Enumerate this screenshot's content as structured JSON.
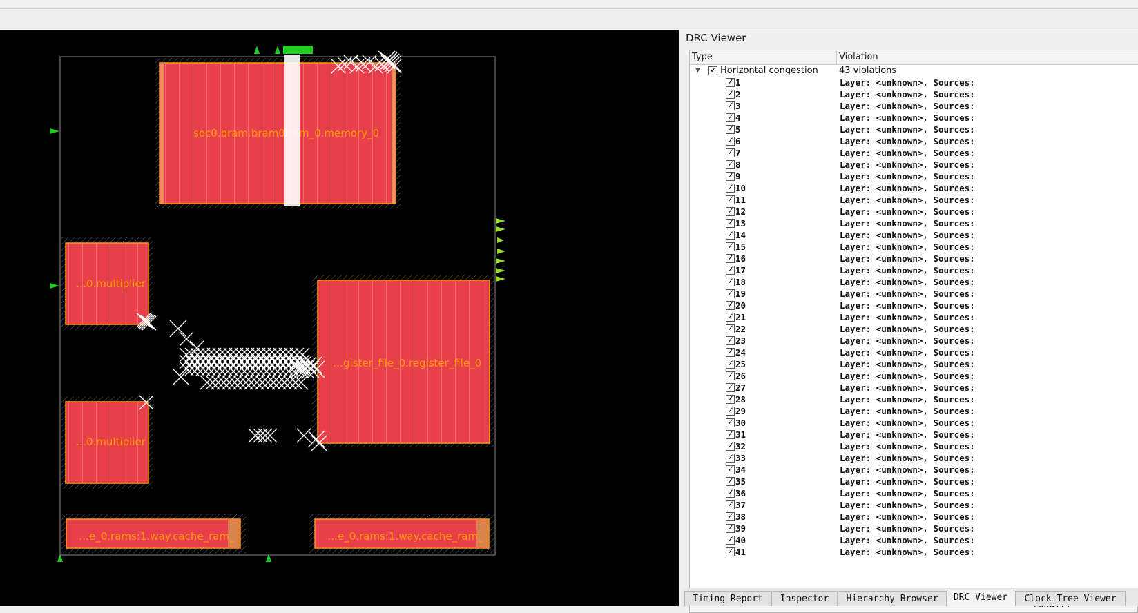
{
  "layout": {
    "blocks": [
      {
        "label": "soc0.bram.bram0.ram_0.memory_0"
      },
      {
        "label": "…0.multiplier"
      },
      {
        "label": "…0.multiplier"
      },
      {
        "label": "…gister_file_0.register_file_0"
      },
      {
        "label": "…e_0.rams:1.way.cache_ram_"
      },
      {
        "label": "…e_0.rams:1.way.cache_ram_"
      }
    ]
  },
  "drc": {
    "title": "DRC Viewer",
    "columns": {
      "type": "Type",
      "violation": "Violation"
    },
    "group": {
      "type": "Horizontal congestion",
      "violation": "43 violations"
    },
    "items": [
      {
        "id": "1",
        "violation": "Layer: <unknown>, Sources:"
      },
      {
        "id": "2",
        "violation": "Layer: <unknown>, Sources:"
      },
      {
        "id": "3",
        "violation": "Layer: <unknown>, Sources:"
      },
      {
        "id": "4",
        "violation": "Layer: <unknown>, Sources:"
      },
      {
        "id": "5",
        "violation": "Layer: <unknown>, Sources:"
      },
      {
        "id": "6",
        "violation": "Layer: <unknown>, Sources:"
      },
      {
        "id": "7",
        "violation": "Layer: <unknown>, Sources:"
      },
      {
        "id": "8",
        "violation": "Layer: <unknown>, Sources:"
      },
      {
        "id": "9",
        "violation": "Layer: <unknown>, Sources:"
      },
      {
        "id": "10",
        "violation": "Layer: <unknown>, Sources:"
      },
      {
        "id": "11",
        "violation": "Layer: <unknown>, Sources:"
      },
      {
        "id": "12",
        "violation": "Layer: <unknown>, Sources:"
      },
      {
        "id": "13",
        "violation": "Layer: <unknown>, Sources:"
      },
      {
        "id": "14",
        "violation": "Layer: <unknown>, Sources:"
      },
      {
        "id": "15",
        "violation": "Layer: <unknown>, Sources:"
      },
      {
        "id": "16",
        "violation": "Layer: <unknown>, Sources:"
      },
      {
        "id": "17",
        "violation": "Layer: <unknown>, Sources:"
      },
      {
        "id": "18",
        "violation": "Layer: <unknown>, Sources:"
      },
      {
        "id": "19",
        "violation": "Layer: <unknown>, Sources:"
      },
      {
        "id": "20",
        "violation": "Layer: <unknown>, Sources:"
      },
      {
        "id": "21",
        "violation": "Layer: <unknown>, Sources:"
      },
      {
        "id": "22",
        "violation": "Layer: <unknown>, Sources:"
      },
      {
        "id": "23",
        "violation": "Layer: <unknown>, Sources:"
      },
      {
        "id": "24",
        "violation": "Layer: <unknown>, Sources:"
      },
      {
        "id": "25",
        "violation": "Layer: <unknown>, Sources:"
      },
      {
        "id": "26",
        "violation": "Layer: <unknown>, Sources:"
      },
      {
        "id": "27",
        "violation": "Layer: <unknown>, Sources:"
      },
      {
        "id": "28",
        "violation": "Layer: <unknown>, Sources:"
      },
      {
        "id": "29",
        "violation": "Layer: <unknown>, Sources:"
      },
      {
        "id": "30",
        "violation": "Layer: <unknown>, Sources:"
      },
      {
        "id": "31",
        "violation": "Layer: <unknown>, Sources:"
      },
      {
        "id": "32",
        "violation": "Layer: <unknown>, Sources:"
      },
      {
        "id": "33",
        "violation": "Layer: <unknown>, Sources:"
      },
      {
        "id": "34",
        "violation": "Layer: <unknown>, Sources:"
      },
      {
        "id": "35",
        "violation": "Layer: <unknown>, Sources:"
      },
      {
        "id": "36",
        "violation": "Layer: <unknown>, Sources:"
      },
      {
        "id": "37",
        "violation": "Layer: <unknown>, Sources:"
      },
      {
        "id": "38",
        "violation": "Layer: <unknown>, Sources:"
      },
      {
        "id": "39",
        "violation": "Layer: <unknown>, Sources:"
      },
      {
        "id": "40",
        "violation": "Layer: <unknown>, Sources:"
      },
      {
        "id": "41",
        "violation": "Layer: <unknown>, Sources:"
      }
    ],
    "load_label": "Load..."
  },
  "tabs": [
    {
      "label": "Timing Report"
    },
    {
      "label": "Inspector"
    },
    {
      "label": "Hierarchy Browser"
    },
    {
      "label": "DRC Viewer",
      "active": true
    },
    {
      "label": "Clock Tree Viewer"
    }
  ],
  "colors": {
    "block_fill": "#e8404a",
    "block_border": "#ff9a00",
    "label": "#ff9a00",
    "pin": "#22cc22",
    "marker": "#ffffff"
  }
}
